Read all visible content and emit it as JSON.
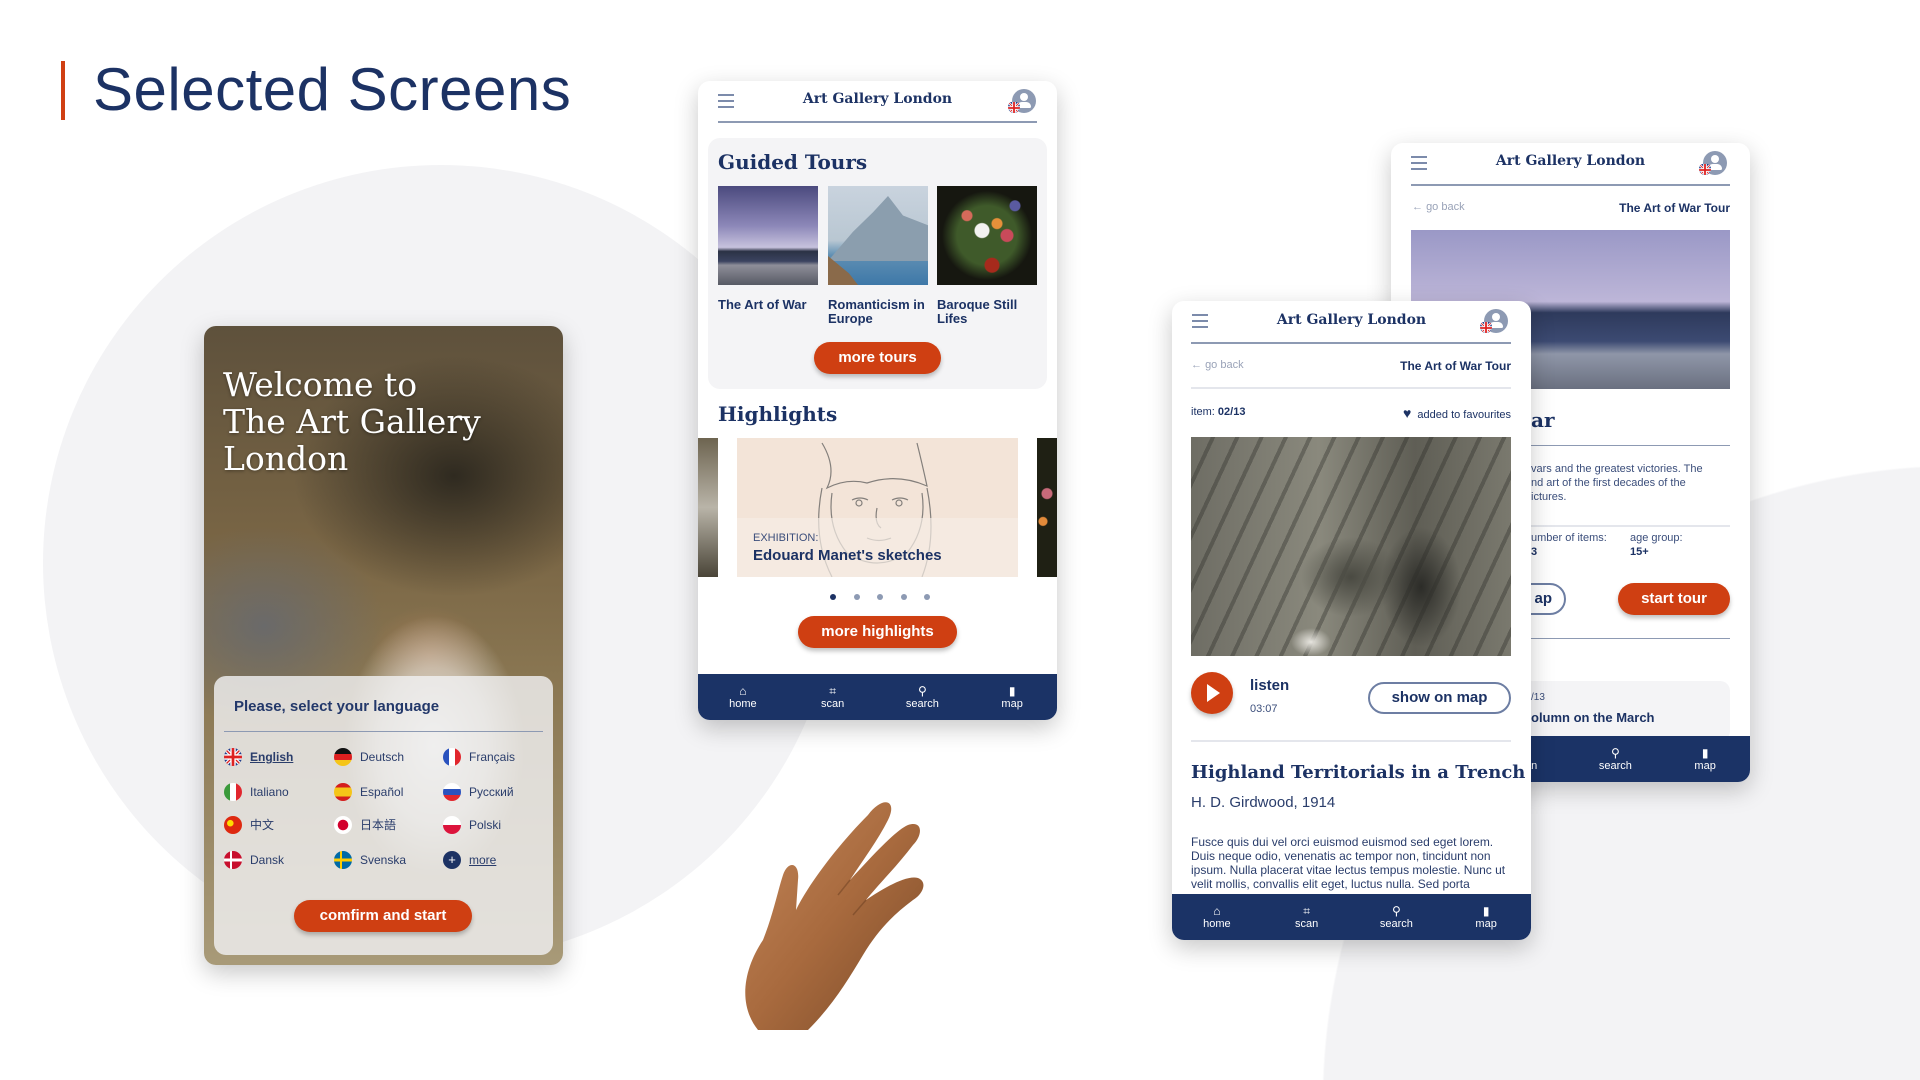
{
  "page": {
    "title": "Selected Screens",
    "accent": "#d03f12",
    "navy": "#1c3264"
  },
  "welcome": {
    "heading": [
      "Welcome to",
      "The Art Gallery",
      "London"
    ],
    "prompt": "Please, select your language",
    "languages": [
      {
        "label": "English",
        "flag": "uk",
        "selected": true
      },
      {
        "label": "Deutsch",
        "flag": "de"
      },
      {
        "label": "Français",
        "flag": "fr"
      },
      {
        "label": "Italiano",
        "flag": "it"
      },
      {
        "label": "Español",
        "flag": "es"
      },
      {
        "label": "Русский",
        "flag": "ru"
      },
      {
        "label": "中文",
        "flag": "cn"
      },
      {
        "label": "日本語",
        "flag": "jp"
      },
      {
        "label": "Polski",
        "flag": "pl"
      },
      {
        "label": "Dansk",
        "flag": "dk"
      },
      {
        "label": "Svenska",
        "flag": "se"
      },
      {
        "label": "more",
        "flag": "plus-icon"
      }
    ],
    "confirm_label": "comfirm and start"
  },
  "app_title": "Art Gallery London",
  "home": {
    "tours_title": "Guided Tours",
    "tours": [
      {
        "label": "The Art of War"
      },
      {
        "label": "Romanticism in Europe"
      },
      {
        "label": "Baroque Still Lifes"
      }
    ],
    "more_tours": "more tours",
    "highlights_title": "Highlights",
    "highlight": {
      "kicker": "EXHIBITION:",
      "title": "Edouard Manet's sketches"
    },
    "carousel": {
      "pages": 5,
      "active": 1
    },
    "more_highlights": "more highlights"
  },
  "nav": [
    {
      "label": "home",
      "icon": "home-icon"
    },
    {
      "label": "scan",
      "icon": "scan-icon"
    },
    {
      "label": "search",
      "icon": "search-icon"
    },
    {
      "label": "map",
      "icon": "map-icon"
    }
  ],
  "item": {
    "go_back": "go back",
    "tour": "The Art of War Tour",
    "item_label": "item:",
    "item_value": "02/13",
    "favourite": "added to favourites",
    "listen": "listen",
    "duration": "03:07",
    "show_on_map": "show on map",
    "title": "Highland Territorials in a Trench",
    "author": "H. D. Girdwood, 1914",
    "body": "Fusce quis dui vel orci euismod euismod sed eget lorem. Duis neque odio, venenatis ac tempor non, tincidunt non ipsum. Nulla placerat vitae lectus tempus molestie. Nunc ut velit mollis, convallis elit eget, luctus nulla. Sed porta"
  },
  "tour": {
    "go_back": "go back",
    "tour": "The Art of War Tour",
    "title_fragment": "ar",
    "desc_fragments": [
      "vars and the greatest victories. The",
      "nd art of the first decades of the",
      "ictures."
    ],
    "items_label": "umber of items:",
    "items_value": "3",
    "age_label": "age group:",
    "age_value": "15+",
    "map_fragment": "ap",
    "start_tour": "start tour",
    "next_index": "/13",
    "next_title": "olumn on the March"
  }
}
